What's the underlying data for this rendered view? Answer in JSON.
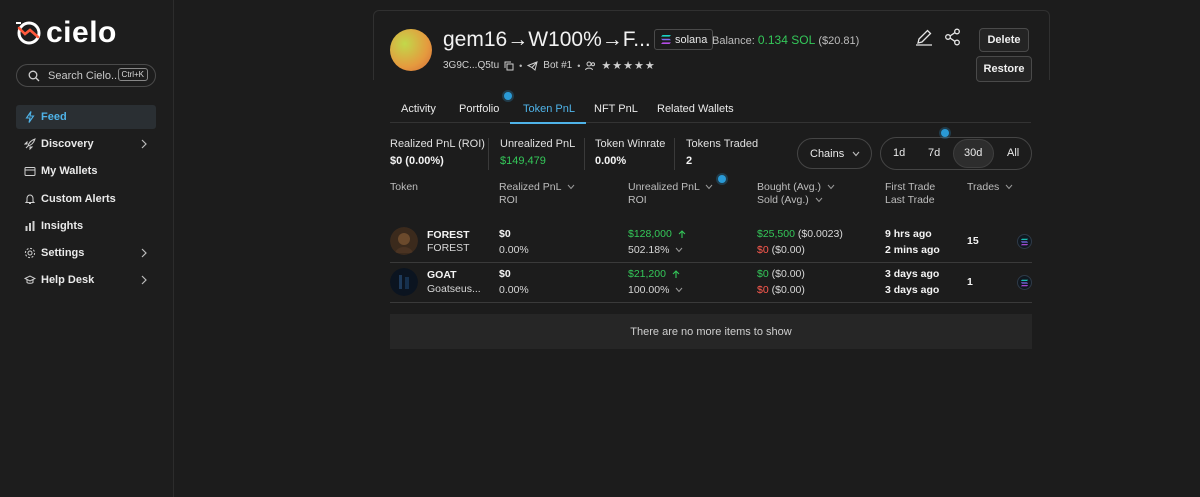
{
  "app": {
    "logo_text": "cielo",
    "search_placeholder": "Search Cielo...",
    "search_shortcut": "Ctrl+K"
  },
  "sidebar": {
    "items": [
      {
        "label": "Feed",
        "icon": "lightning-icon",
        "active": true
      },
      {
        "label": "Discovery",
        "icon": "rocket-icon",
        "has_submenu": true
      },
      {
        "label": "My Wallets",
        "icon": "wallet-icon"
      },
      {
        "label": "Custom Alerts",
        "icon": "bell-icon"
      },
      {
        "label": "Insights",
        "icon": "bar-chart-icon"
      },
      {
        "label": "Settings",
        "icon": "gear-icon",
        "has_submenu": true
      },
      {
        "label": "Help Desk",
        "icon": "graduation-cap-icon",
        "has_submenu": true
      }
    ]
  },
  "wallet": {
    "name": "gem16→W100%→F...",
    "chain": "solana",
    "balance_label": "Balance:",
    "balance_sol": "0.134 SOL",
    "balance_usd": "($20.81)",
    "address": "3G9C...Q5tu",
    "bot_label": "Bot #1",
    "rating_stars": "★★★★★",
    "delete_label": "Delete",
    "restore_label": "Restore"
  },
  "tabs": [
    {
      "label": "Activity"
    },
    {
      "label": "Portfolio"
    },
    {
      "label": "Token PnL",
      "active": true
    },
    {
      "label": "NFT PnL"
    },
    {
      "label": "Related Wallets"
    }
  ],
  "stats": {
    "realized_label": "Realized PnL (ROI)",
    "realized_value": "$0 (0.00%)",
    "unrealized_label": "Unrealized PnL",
    "unrealized_value": "$149,479",
    "winrate_label": "Token Winrate",
    "winrate_value": "0.00%",
    "traded_label": "Tokens Traded",
    "traded_value": "2"
  },
  "filters": {
    "chains_label": "Chains",
    "periods": [
      "1d",
      "7d",
      "30d",
      "All"
    ],
    "active_period": "30d"
  },
  "table": {
    "headers": {
      "token": "Token",
      "realized": "Realized PnL",
      "realized_sub": "ROI",
      "unrealized": "Unrealized PnL",
      "unrealized_sub": "ROI",
      "bought": "Bought (Avg.)",
      "sold": "Sold (Avg.)",
      "first_trade": "First Trade",
      "last_trade": "Last Trade",
      "trades": "Trades"
    },
    "rows": [
      {
        "symbol": "FOREST",
        "name": "FOREST",
        "realized": "$0",
        "realized_roi": "0.00%",
        "unrealized": "$128,000",
        "unrealized_roi": "502.18%",
        "bought": "$25,500",
        "bought_avg": "($0.0023)",
        "sold": "$0",
        "sold_avg": "($0.00)",
        "first_trade": "9 hrs ago",
        "last_trade": "2 mins ago",
        "trades": "15"
      },
      {
        "symbol": "GOAT",
        "name": "Goatseus...",
        "realized": "$0",
        "realized_roi": "0.00%",
        "unrealized": "$21,200",
        "unrealized_roi": "100.00%",
        "bought": "$0",
        "bought_avg": "($0.00)",
        "sold": "$0",
        "sold_avg": "($0.00)",
        "first_trade": "3 days ago",
        "last_trade": "3 days ago",
        "trades": "1"
      }
    ],
    "empty_message": "There are no more items to show"
  },
  "colors": {
    "accent": "#4fb3e8",
    "positive": "#34c759",
    "negative": "#ff5a4f",
    "background": "#1c1c1c"
  }
}
